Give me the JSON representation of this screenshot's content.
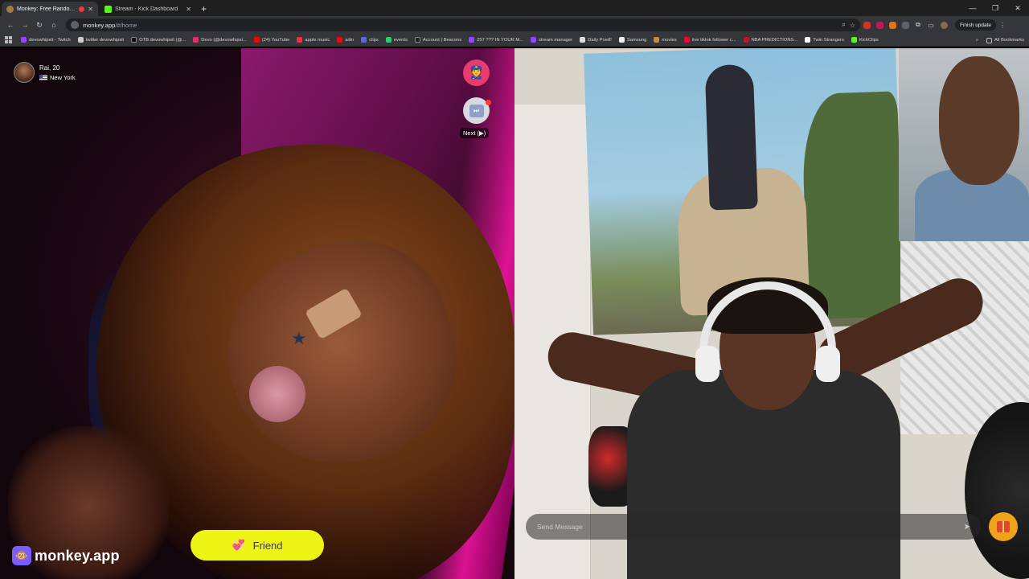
{
  "browser": {
    "tabs": [
      {
        "title": "Monkey: Free Random Vide",
        "favicon_color": "#a87a4a",
        "active": true
      },
      {
        "title": "Stream - Kick Dashboard",
        "favicon_color": "#53fc18",
        "active": false
      }
    ],
    "new_tab": "+",
    "url_host": "monkey.app",
    "url_path": "/#/home",
    "finish_update": "Finish update",
    "bookmarks": [
      {
        "label": "devowhipsit - Twitch",
        "color": "#9146ff"
      },
      {
        "label": "twitter devowhipsit",
        "color": "#cccccc"
      },
      {
        "label": "OTB devowhipsit (@...",
        "color": "#111111"
      },
      {
        "label": "Devo (@devowhipsi...",
        "color": "#e1306c"
      },
      {
        "label": "(24) YouTube",
        "color": "#ff0000"
      },
      {
        "label": "apple music",
        "color": "#fa2d48"
      },
      {
        "label": "adin",
        "color": "#ff0000"
      },
      {
        "label": "clips",
        "color": "#5865f2"
      },
      {
        "label": "events",
        "color": "#2ecc71"
      },
      {
        "label": "Account | Beacons",
        "color": "#222222"
      },
      {
        "label": "257 ??? IN YOUR M...",
        "color": "#9146ff"
      },
      {
        "label": "stream manager",
        "color": "#9146ff"
      },
      {
        "label": "Daily Poetf!",
        "color": "#dddddd"
      },
      {
        "label": "Samsung",
        "color": "#eeeeee"
      },
      {
        "label": "movies",
        "color": "#c98a3a"
      },
      {
        "label": "live tiktok follower c...",
        "color": "#ff0033"
      },
      {
        "label": "NBA PREDICTIONS...",
        "color": "#c8102e"
      },
      {
        "label": "Twin Strangers",
        "color": "#ffffff"
      },
      {
        "label": "KickClips",
        "color": "#53fc18"
      }
    ],
    "all_bookmarks": "All Bookmarks"
  },
  "left_video": {
    "user_name": "Rai, 20",
    "user_location": "New York",
    "next_tooltip": "Next (▶)",
    "friend_label": "Friend",
    "brand_text": "monkey.app"
  },
  "right_video": {
    "message_placeholder": "Send Message"
  },
  "colors": {
    "friend_button": "#eef515",
    "police_button": "#e83c6e",
    "gift_button": "#f0a21a",
    "brand_accent": "#7b5cff"
  }
}
